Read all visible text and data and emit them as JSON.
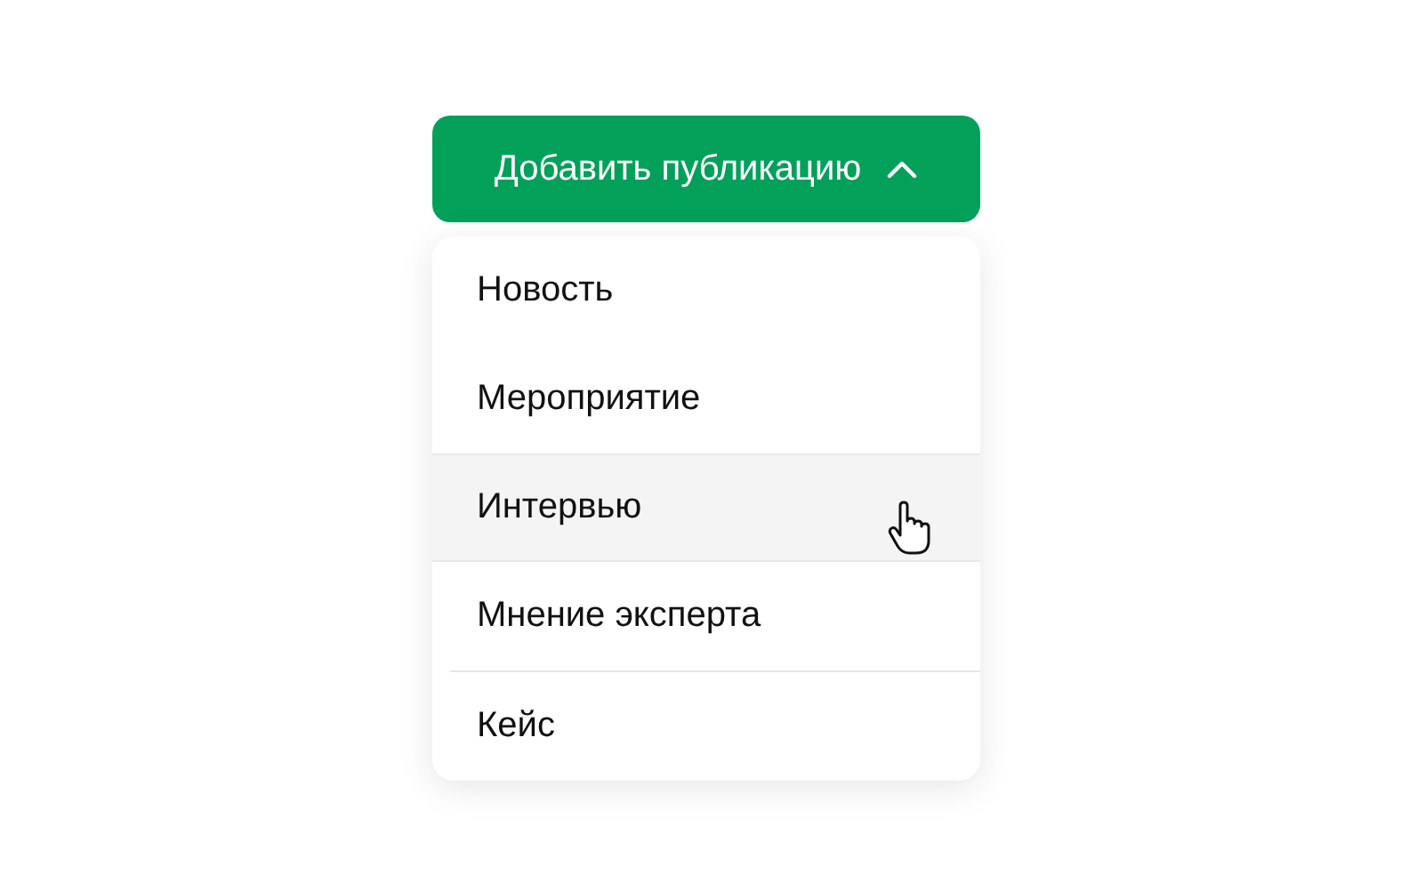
{
  "button": {
    "label": "Добавить публикацию",
    "expanded": true
  },
  "menu": {
    "items": [
      {
        "label": "Новость",
        "selected": false,
        "divider_above": false
      },
      {
        "label": "Мероприятие",
        "selected": false,
        "divider_above": false
      },
      {
        "label": "Интервью",
        "selected": true,
        "divider_above": false
      },
      {
        "label": "Мнение эксперта",
        "selected": false,
        "divider_above": false
      },
      {
        "label": "Кейс",
        "selected": false,
        "divider_above": true
      }
    ]
  }
}
